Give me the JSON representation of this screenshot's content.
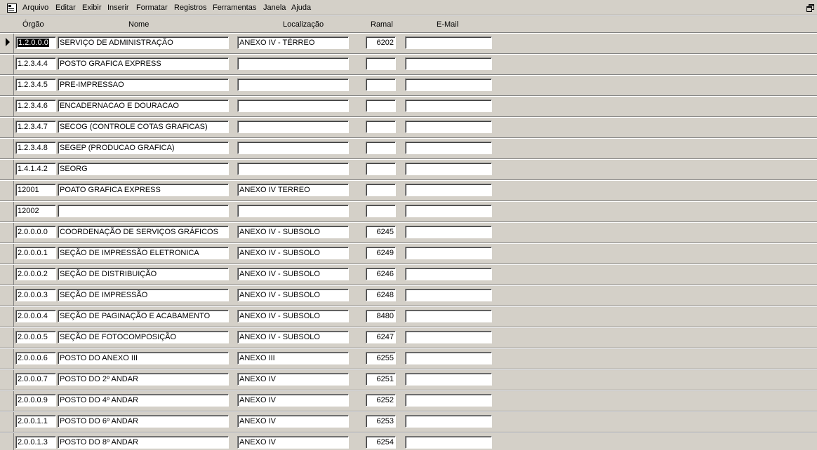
{
  "menu": {
    "items": [
      "Arquivo",
      "Editar",
      "Exibir",
      "Inserir",
      "Formatar",
      "Registros",
      "Ferramentas",
      "Janela",
      "Ajuda"
    ]
  },
  "columns": {
    "orgao": "Órgão",
    "nome": "Nome",
    "localizacao": "Localização",
    "ramal": "Ramal",
    "email": "E-Mail"
  },
  "rows": [
    {
      "orgao": "1.2.0.0.0",
      "nome": "SERVIÇO DE ADMINISTRAÇÃO",
      "localizacao": "ANEXO IV - TÉRREO",
      "ramal": "6202",
      "email": ""
    },
    {
      "orgao": "1.2.3.4.4",
      "nome": "POSTO GRAFICA EXPRESS",
      "localizacao": "",
      "ramal": "",
      "email": ""
    },
    {
      "orgao": "1.2.3.4.5",
      "nome": "PRE-IMPRESSAO",
      "localizacao": "",
      "ramal": "",
      "email": ""
    },
    {
      "orgao": "1.2.3.4.6",
      "nome": "ENCADERNACAO E DOURACAO",
      "localizacao": "",
      "ramal": "",
      "email": ""
    },
    {
      "orgao": "1.2.3.4.7",
      "nome": "SECOG (CONTROLE COTAS GRAFICAS)",
      "localizacao": "",
      "ramal": "",
      "email": ""
    },
    {
      "orgao": "1.2.3.4.8",
      "nome": "SEGEP (PRODUCAO GRAFICA)",
      "localizacao": "",
      "ramal": "",
      "email": ""
    },
    {
      "orgao": "1.4.1.4.2",
      "nome": "SEORG",
      "localizacao": "",
      "ramal": "",
      "email": ""
    },
    {
      "orgao": "12001",
      "nome": "POATO GRAFICA EXPRESS",
      "localizacao": "ANEXO IV TERREO",
      "ramal": "",
      "email": ""
    },
    {
      "orgao": "12002",
      "nome": "",
      "localizacao": "",
      "ramal": "",
      "email": ""
    },
    {
      "orgao": "2.0.0.0.0",
      "nome": "COORDENAÇÃO DE SERVIÇOS GRÁFICOS",
      "localizacao": "ANEXO IV - SUBSOLO",
      "ramal": "6245",
      "email": ""
    },
    {
      "orgao": "2.0.0.0.1",
      "nome": "SEÇÃO DE IMPRESSÃO ELETRONICA",
      "localizacao": "ANEXO IV - SUBSOLO",
      "ramal": "6249",
      "email": ""
    },
    {
      "orgao": "2.0.0.0.2",
      "nome": "SEÇÃO DE DISTRIBUIÇÃO",
      "localizacao": "ANEXO IV - SUBSOLO",
      "ramal": "6246",
      "email": ""
    },
    {
      "orgao": "2.0.0.0.3",
      "nome": "SEÇÃO DE IMPRESSÃO",
      "localizacao": "ANEXO IV - SUBSOLO",
      "ramal": "6248",
      "email": ""
    },
    {
      "orgao": "2.0.0.0.4",
      "nome": "SEÇÃO DE PAGINAÇÃO E ACABAMENTO",
      "localizacao": "ANEXO IV - SUBSOLO",
      "ramal": "8480",
      "email": ""
    },
    {
      "orgao": "2.0.0.0.5",
      "nome": "SEÇÃO DE FOTOCOMPOSIÇÃO",
      "localizacao": "ANEXO IV - SUBSOLO",
      "ramal": "6247",
      "email": ""
    },
    {
      "orgao": "2.0.0.0.6",
      "nome": "POSTO DO ANEXO III",
      "localizacao": "ANEXO III",
      "ramal": "6255",
      "email": ""
    },
    {
      "orgao": "2.0.0.0.7",
      "nome": "POSTO DO 2º ANDAR",
      "localizacao": "ANEXO IV",
      "ramal": "6251",
      "email": ""
    },
    {
      "orgao": "2.0.0.0.9",
      "nome": "POSTO DO 4º ANDAR",
      "localizacao": "ANEXO IV",
      "ramal": "6252",
      "email": ""
    },
    {
      "orgao": "2.0.0.1.1",
      "nome": "POSTO DO 6º ANDAR",
      "localizacao": "ANEXO IV",
      "ramal": "6253",
      "email": ""
    },
    {
      "orgao": "2.0.0.1.3",
      "nome": "POSTO DO 8º ANDAR",
      "localizacao": "ANEXO IV",
      "ramal": "6254",
      "email": ""
    }
  ]
}
